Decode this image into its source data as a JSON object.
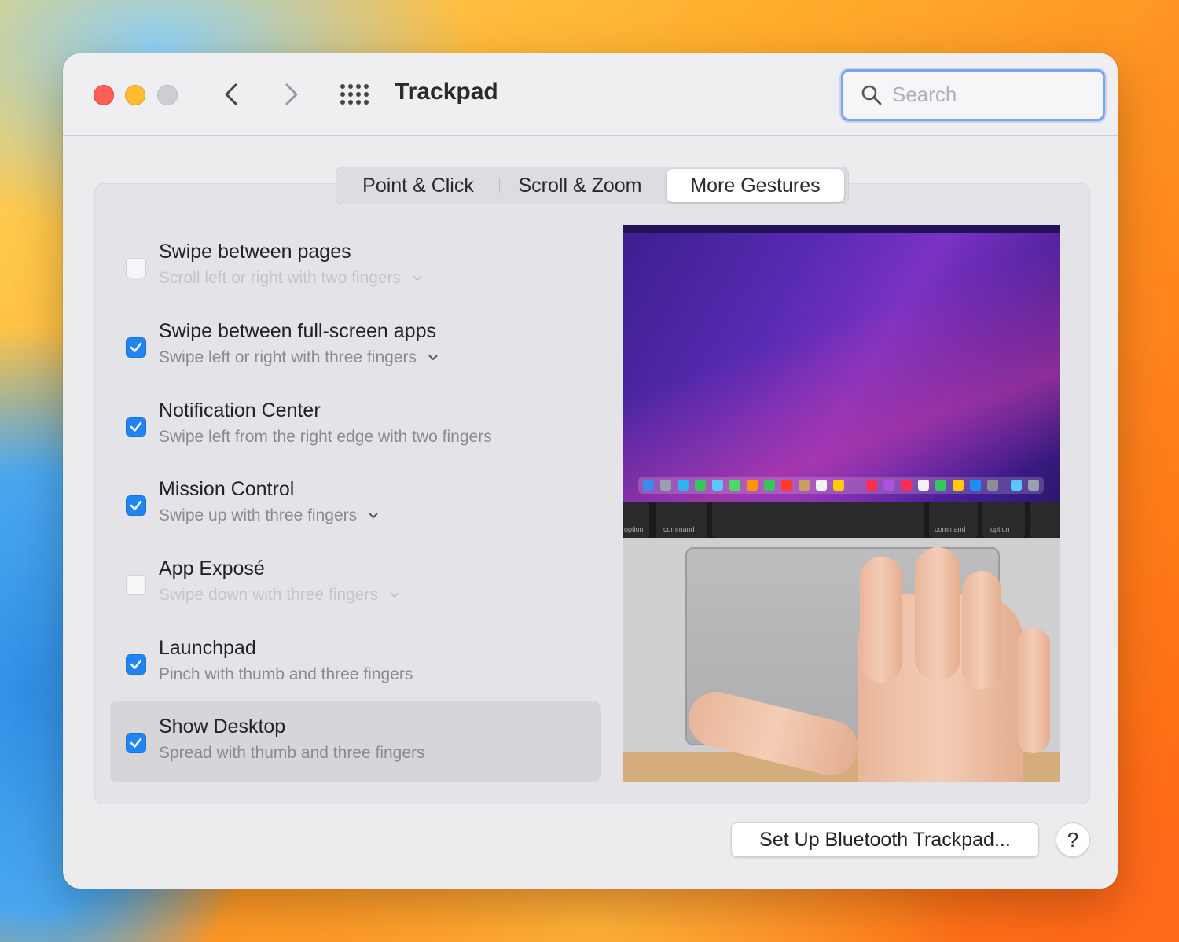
{
  "window": {
    "title": "Trackpad"
  },
  "search": {
    "placeholder": "Search"
  },
  "tabs": [
    {
      "label": "Point & Click",
      "selected": false
    },
    {
      "label": "Scroll & Zoom",
      "selected": false
    },
    {
      "label": "More Gestures",
      "selected": true
    }
  ],
  "gestures": [
    {
      "title": "Swipe between pages",
      "subtitle": "Scroll left or right with two fingers",
      "checked": false,
      "has_menu": true
    },
    {
      "title": "Swipe between full-screen apps",
      "subtitle": "Swipe left or right with three fingers",
      "checked": true,
      "has_menu": true
    },
    {
      "title": "Notification Center",
      "subtitle": "Swipe left from the right edge with two fingers",
      "checked": true,
      "has_menu": false
    },
    {
      "title": "Mission Control",
      "subtitle": "Swipe up with three fingers",
      "checked": true,
      "has_menu": true
    },
    {
      "title": "App Exposé",
      "subtitle": "Swipe down with three fingers",
      "checked": false,
      "has_menu": true
    },
    {
      "title": "Launchpad",
      "subtitle": "Pinch with thumb and three fingers",
      "checked": true,
      "has_menu": false
    },
    {
      "title": "Show Desktop",
      "subtitle": "Spread with thumb and three fingers",
      "checked": true,
      "has_menu": false,
      "selected": true
    }
  ],
  "preview": {
    "keys": [
      "option",
      "command",
      "command",
      "option"
    ]
  },
  "footer": {
    "bluetooth_label": "Set Up Bluetooth Trackpad...",
    "help_label": "?"
  },
  "colors": {
    "accent": "#1f84f5",
    "close": "#ff5f57",
    "minimize": "#febc2e"
  }
}
